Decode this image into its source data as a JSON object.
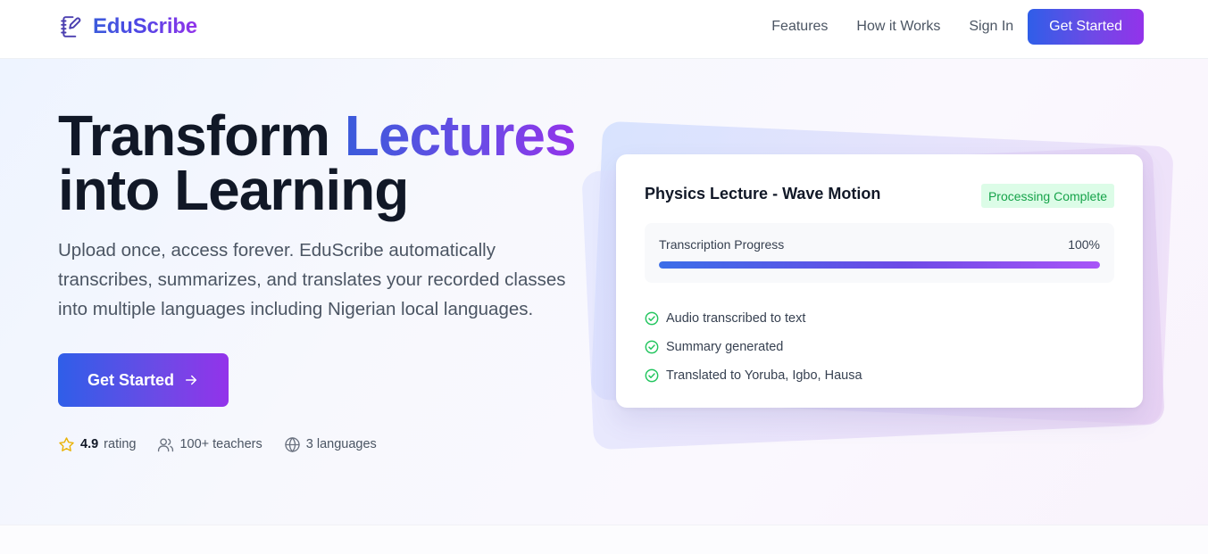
{
  "header": {
    "brand_name": "EduScribe",
    "brand_icon": "notebook-pen-icon",
    "nav": [
      {
        "label": "Features"
      },
      {
        "label": "How it Works"
      },
      {
        "label": "Sign In"
      }
    ],
    "cta_label": "Get Started"
  },
  "hero": {
    "headline_part1": "Transform ",
    "headline_accent": "Lectures",
    "headline_line2": "into Learning",
    "subtext": "Upload once, access forever. EduScribe automatically transcribes, summarizes, and translates your recorded classes into multiple languages including Nigerian local languages.",
    "cta_label": "Get Started",
    "cta_icon": "arrow-right-icon",
    "stats": {
      "rating_value": "4.9",
      "rating_label": "rating",
      "teachers": "100+ teachers",
      "languages": "3 languages"
    }
  },
  "card": {
    "title": "Physics Lecture - Wave Motion",
    "badge": "Processing Complete",
    "progress_label": "Transcription Progress",
    "progress_value": "100%",
    "progress_fraction": 1.0,
    "checklist": [
      {
        "label": "Audio transcribed to text"
      },
      {
        "label": "Summary generated"
      },
      {
        "label": "Translated to Yoruba, Igbo, Hausa"
      }
    ]
  },
  "colors": {
    "brand_blue": "#2f5ee8",
    "brand_purple": "#9333ea",
    "success_green": "#16a34a",
    "success_bg": "#dcfce7",
    "star_yellow": "#eab308"
  }
}
